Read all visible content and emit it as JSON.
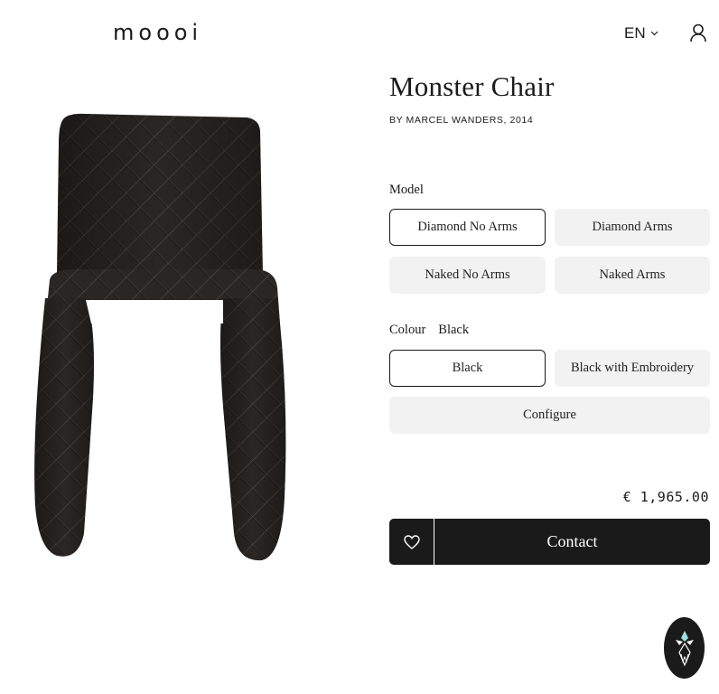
{
  "header": {
    "logo": "moooi",
    "language": "EN",
    "icons": {
      "language_caret": "chevron-down-icon",
      "account": "user-icon"
    }
  },
  "product": {
    "image_alt": "Black quilted Monster Chair",
    "title": "Monster Chair",
    "designer": "BY MARCEL WANDERS, 2014",
    "model": {
      "label": "Model",
      "options": [
        "Diamond No Arms",
        "Diamond Arms",
        "Naked No Arms",
        "Naked Arms"
      ],
      "selected": "Diamond No Arms"
    },
    "colour": {
      "label": "Colour",
      "value": "Black",
      "options": [
        "Black",
        "Black with Embroidery"
      ],
      "selected": "Black"
    },
    "configure_label": "Configure",
    "price": "€ 1,965.00",
    "contact_label": "Contact",
    "icons": {
      "favourite": "heart-icon",
      "chat": "moooi-chat-icon"
    }
  },
  "colors": {
    "ink": "#1a1a1a",
    "option_bg": "#f2f2f2",
    "page_bg": "#ffffff"
  }
}
